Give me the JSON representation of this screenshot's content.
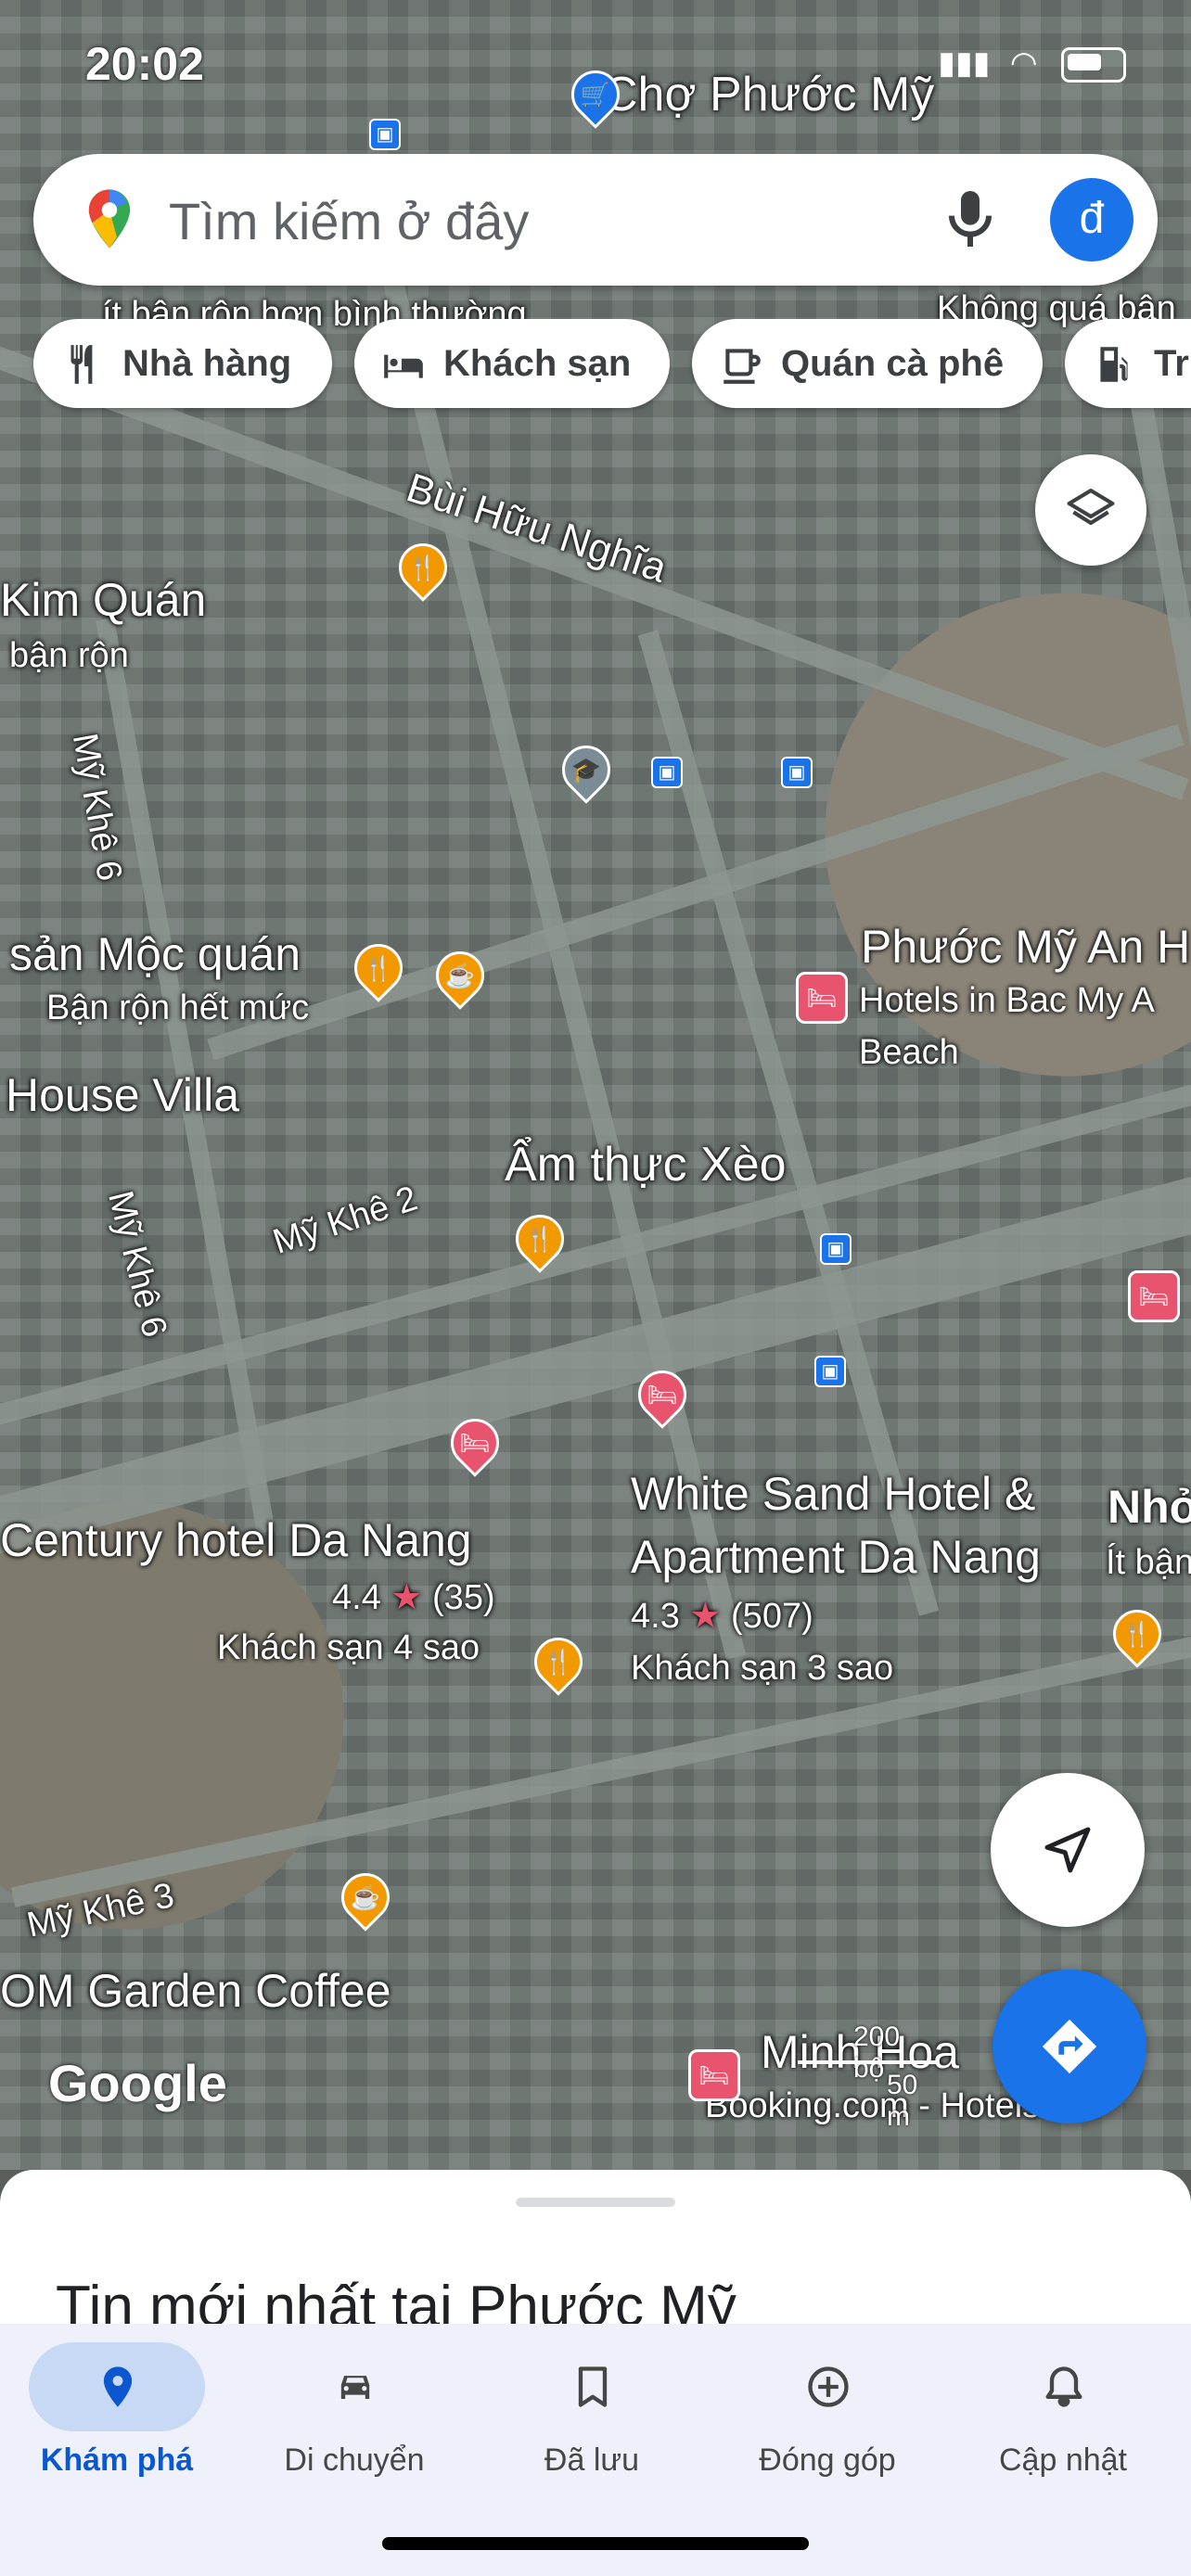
{
  "status": {
    "time": "20:02"
  },
  "search": {
    "placeholder": "Tìm kiếm ở đây",
    "avatar_letter": "đ"
  },
  "chips": [
    {
      "label": "Nhà hàng",
      "icon": "fork-knife-icon"
    },
    {
      "label": "Khách sạn",
      "icon": "bed-icon"
    },
    {
      "label": "Quán cà phê",
      "icon": "coffee-icon"
    },
    {
      "label": "Tr",
      "icon": "gas-pump-icon"
    }
  ],
  "map": {
    "labels": {
      "cho_phuoc_my": "Chợ Phước Mỹ",
      "it_ban_ron": "ít bận rộn hơn bình thường",
      "khong_qua_ban": "Không quá bận",
      "bui_huu_nghia": "Bùi Hữu Nghĩa",
      "kim_quan": "Kim Quán",
      "ban_ron": "bận rộn",
      "my_khe_6a": "Mỹ Khê 6",
      "moc_quan": "sản Mộc quán",
      "ban_ron_het_muc": "Bận rộn hết mức",
      "phuoc_my_an": "Phước Mỹ An H",
      "hotels_in_bac": "Hotels in Bac My A",
      "beach": "Beach",
      "house_villa": "House Villa",
      "my_khe_2": "Mỹ Khê 2",
      "am_thuc_xeo": "Ẩm thực Xèo",
      "my_khe_6b": "Mỹ Khê 6",
      "century": "Century hotel Da Nang",
      "century_rating": "4.4",
      "century_reviews": "(35)",
      "century_type": "Khách sạn 4 sao",
      "white_sand_1": "White Sand Hotel &",
      "white_sand_2": "Apartment Da Nang",
      "white_sand_rating": "4.3",
      "white_sand_reviews": "(507)",
      "white_sand_type": "Khách sạn 3 sao",
      "nho": "Nhỏ",
      "it_ban": "Ít bận",
      "my_khe_3": "Mỹ Khê 3",
      "garden_coffee": "OM Garden Coffee",
      "minh_hoa": "Minh Hoa",
      "booking": "Booking.com - Hotels"
    },
    "google_logo": "Google",
    "scale": {
      "top": "200 bộ",
      "bottom": "50 m"
    }
  },
  "sheet": {
    "title": "Tin mới nhất tại Phước Mỹ"
  },
  "nav": [
    {
      "label": "Khám phá",
      "icon": "location-pin-icon",
      "active": true
    },
    {
      "label": "Di chuyển",
      "icon": "car-icon",
      "active": false
    },
    {
      "label": "Đã lưu",
      "icon": "bookmark-icon",
      "active": false
    },
    {
      "label": "Đóng góp",
      "icon": "add-circle-icon",
      "active": false
    },
    {
      "label": "Cập nhật",
      "icon": "bell-icon",
      "active": false
    }
  ],
  "colors": {
    "accent": "#1a73e8",
    "nav_active": "#0b57d0",
    "food_pin": "#f29900",
    "hotel_pin": "#e8546e"
  }
}
